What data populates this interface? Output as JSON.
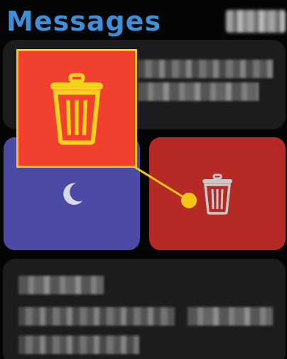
{
  "app": {
    "title": "Messages"
  },
  "status": {
    "clock": ""
  },
  "actions": {
    "do_not_disturb_icon": "moon-icon",
    "delete_icon": "trash-icon"
  },
  "colors": {
    "title_blue": "#3f8fd8",
    "dnd_tile": "#4b4aa4",
    "delete_tile": "#b52a24",
    "callout_fill": "#f2402f",
    "highlight_yellow": "#f5c518"
  }
}
